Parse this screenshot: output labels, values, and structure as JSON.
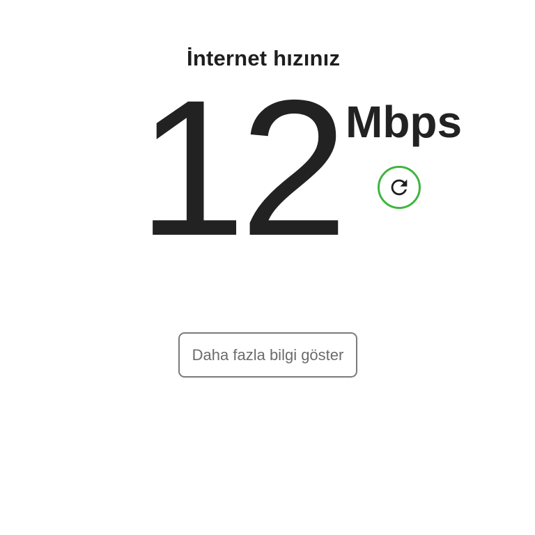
{
  "speed": {
    "title": "İnternet hızınız",
    "value": "12",
    "unit": "Mbps"
  },
  "refresh": {
    "icon": "refresh-icon",
    "ring_color": "#3fb53f"
  },
  "more_info": {
    "label": "Daha fazla bilgi göster"
  },
  "colors": {
    "text": "#222222",
    "button_border": "#7a7a7a",
    "button_text": "#6b6b6b",
    "accent": "#3fb53f"
  }
}
